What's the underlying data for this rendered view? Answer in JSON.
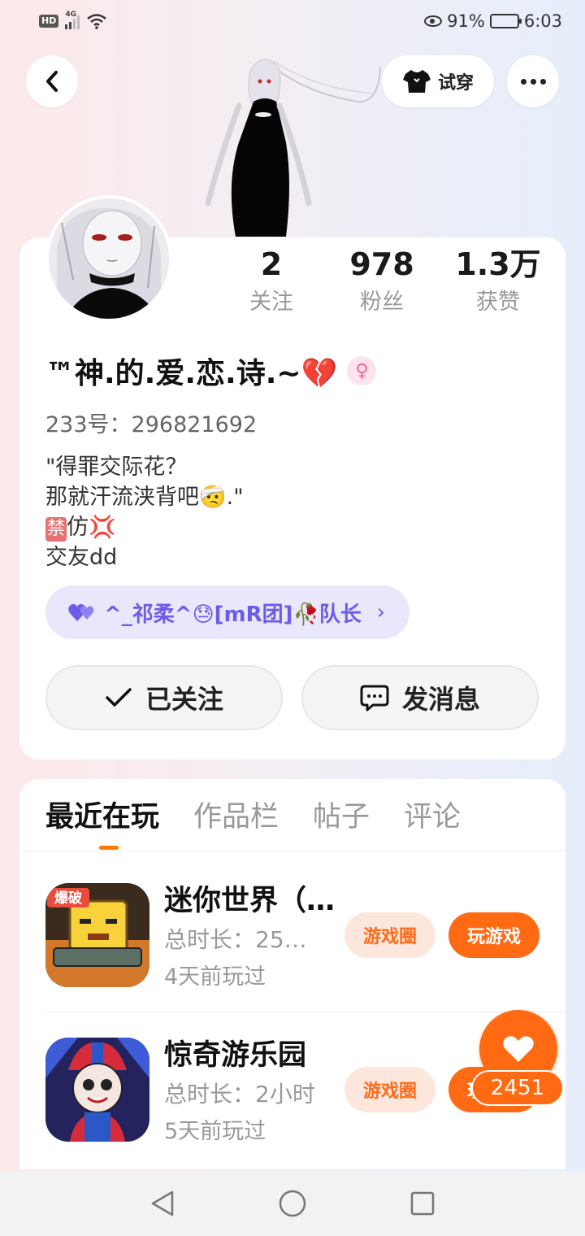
{
  "status_bar": {
    "hd": "HD",
    "network": "4G",
    "battery_percent": "91%",
    "time": "6:03",
    "battery_level": 0.91
  },
  "header": {
    "tryon_label": "试穿"
  },
  "profile": {
    "stats": [
      {
        "value": "2",
        "label": "关注"
      },
      {
        "value": "978",
        "label": "粉丝"
      },
      {
        "value": "1.3万",
        "label": "获赞"
      }
    ],
    "username": "™神.的.爱.恋.诗.~💔",
    "gender_symbol": "♀",
    "uid": "233号：296821692",
    "bio": {
      "line1": "\"得罪交际花？",
      "line2": "那就汗流浃背吧🤕.\"",
      "line3_badge": "禁",
      "line3_text": "仿💢",
      "line4": "交友dd"
    },
    "team": "^_祁柔^😓[mR团]🥀队长",
    "follow_label": "已关注",
    "message_label": "发消息"
  },
  "tabs": [
    "最近在玩",
    "作品栏",
    "帖子",
    "评论"
  ],
  "games": [
    {
      "name": "迷你世界（…",
      "duration": "总时长：25…",
      "last_played": "4天前玩过",
      "circle_label": "游戏圈",
      "play_label": "玩游戏"
    },
    {
      "name": "惊奇游乐园",
      "duration": "总时长：2小时",
      "last_played": "5天前玩过",
      "circle_label": "游戏圈",
      "play_label": "玩游戏"
    }
  ],
  "like": {
    "count": "2451"
  },
  "colors": {
    "accent": "#ff6a12",
    "team_chip": "#6c5ce7"
  }
}
